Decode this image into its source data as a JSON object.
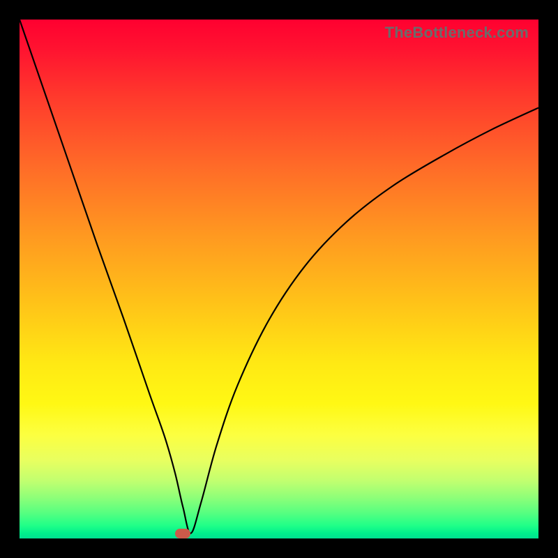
{
  "watermark": "TheBottleneck.com",
  "chart_data": {
    "type": "line",
    "title": "",
    "xlabel": "",
    "ylabel": "",
    "xlim": [
      0,
      100
    ],
    "ylim": [
      0,
      100
    ],
    "series": [
      {
        "name": "curve",
        "x": [
          0,
          5,
          10,
          15,
          20,
          25,
          28,
          30,
          31.5,
          33,
          35,
          38,
          42,
          48,
          55,
          63,
          72,
          82,
          91,
          100
        ],
        "y": [
          100,
          85.5,
          71,
          56.5,
          42.5,
          28,
          19.5,
          12.5,
          6,
          1,
          7,
          18,
          29.5,
          42,
          52.5,
          61,
          68,
          74,
          78.8,
          83
        ]
      }
    ],
    "marker": {
      "x": 31.5,
      "y": 1
    },
    "colors": {
      "curve": "#000000",
      "marker": "#cc5a4a",
      "gradient_top": "#ff0030",
      "gradient_bottom": "#00e090"
    }
  }
}
